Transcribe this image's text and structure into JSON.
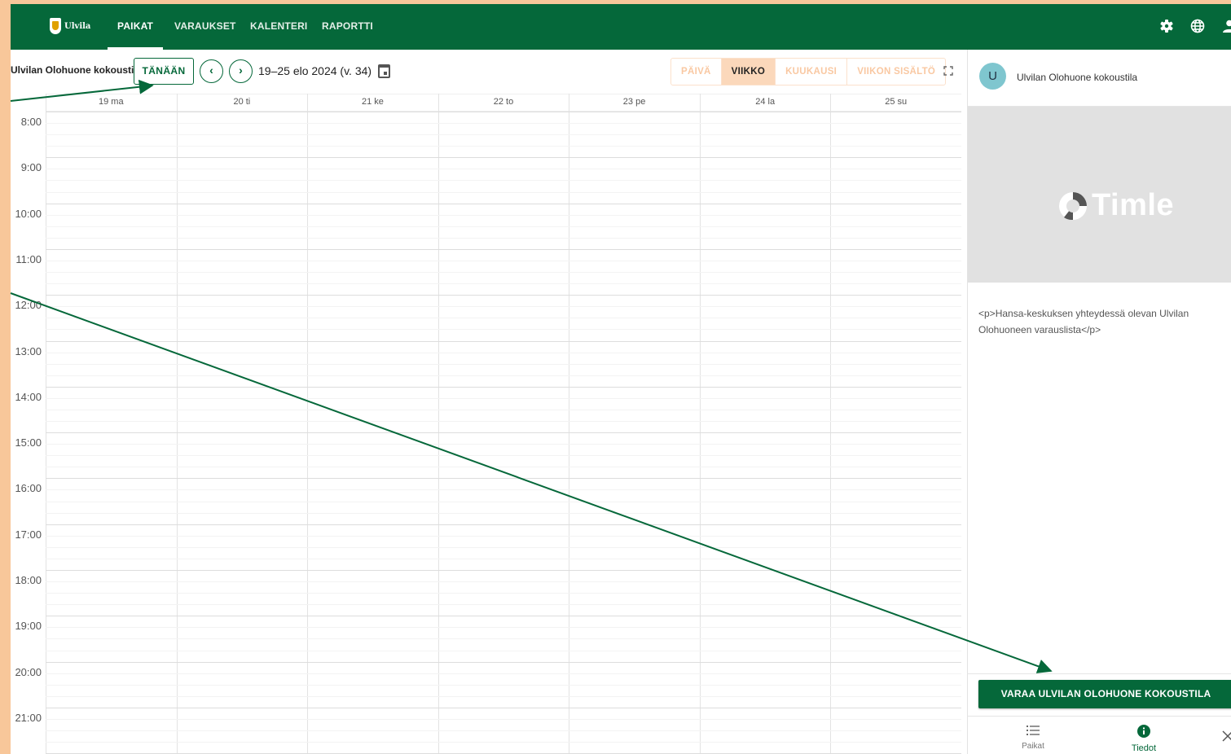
{
  "app": {
    "logo_text": "Ulvila",
    "nav": [
      {
        "label": "PAIKAT",
        "active": true
      },
      {
        "label": "VARAUKSET",
        "active": false
      },
      {
        "label": "KALENTERI",
        "active": false
      },
      {
        "label": "RAPORTTI",
        "active": false
      }
    ],
    "icons": [
      "gear-icon",
      "globe-icon",
      "user-icon"
    ]
  },
  "toolbar": {
    "resource_title": "Ulvilan Olohuone kokoustila",
    "today_label": "TÄNÄÄN",
    "prev_symbol": "‹",
    "next_symbol": "›",
    "range_label": "19–25 elo 2024 (v. 34)",
    "views": [
      {
        "label": "PÄIVÄ",
        "active": false
      },
      {
        "label": "VIIKKO",
        "active": true
      },
      {
        "label": "KUUKAUSI",
        "active": false
      },
      {
        "label": "VIIKON SISÄLTÖ",
        "active": false
      }
    ]
  },
  "calendar": {
    "days": [
      "19 ma",
      "20 ti",
      "21 ke",
      "22 to",
      "23 pe",
      "24 la",
      "25 su"
    ],
    "hours": [
      "8:00",
      "9:00",
      "10:00",
      "11:00",
      "12:00",
      "13:00",
      "14:00",
      "15:00",
      "16:00",
      "17:00",
      "18:00",
      "19:00",
      "20:00",
      "21:00"
    ]
  },
  "side_panel": {
    "avatar_letter": "U",
    "title": "Ulvilan Olohuone kokoustila",
    "image_brand": "Timle",
    "description": "<p>Hansa-keskuksen yhteydessä olevan Ulvilan Olohuoneen varauslista</p>",
    "book_button": "VARAA ULVILAN OLOHUONE KOKOUSTILA",
    "bottom_nav": [
      {
        "label": "Paikat",
        "icon": "list-icon",
        "active": false
      },
      {
        "label": "Tiedot",
        "icon": "info-icon",
        "active": true
      }
    ]
  },
  "colors": {
    "brand_green": "#05683a",
    "frame_peach": "#f8c79a",
    "view_active_bg": "#fbd8bb",
    "avatar_bg": "#7fc6cf"
  }
}
